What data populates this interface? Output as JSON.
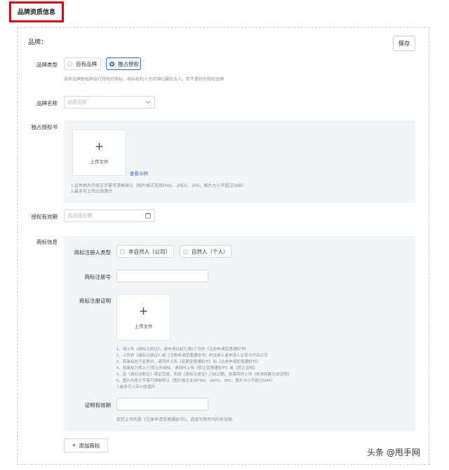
{
  "header": {
    "title": "品牌资质信息"
  },
  "brand_section": {
    "label": "品牌：",
    "save_label": "保存"
  },
  "brand_type": {
    "label": "品牌类型",
    "options": [
      "自有品牌",
      "独占授权"
    ],
    "selected": "独占授权",
    "hint": "自有品牌即品牌自行持有的商标。商标权利人为店铺归属的法人。若不是则为授权品牌"
  },
  "brand_name": {
    "label": "品牌名称",
    "placeholder": "品牌名称"
  },
  "license": {
    "label": "独占授权书",
    "upload_text": "上传文件",
    "example_link": "查看示例",
    "hints": [
      "1.证件图片内容文字需可清晰辨认（图片格式支持PNG、JPEG、JPG，图片大小不超过5MB）",
      "2.最多可上传20张图片"
    ]
  },
  "validity": {
    "label": "授权有效期",
    "placeholder": "请选择日期"
  },
  "trademark": {
    "label": "商标信息",
    "registrant_type_label": "商标注册人类型",
    "registrant_options": [
      "非自然人（公司）",
      "自然人（个人）"
    ],
    "reg_no_label": "商标注册号",
    "certificate_label": "商标注册证明",
    "upload_text": "上传文件",
    "hints": [
      "1、请上传《商标注册证》，或申请日起已满6个月的《注册申请受理通知书》",
      "2、上传的《商标注册证》或《注册申请受理通知书》的注册人或申请人必须为开店公司",
      "3、若商标处于变更中，请同时上传《变更受理通知书》和《注册申请受理通知书》",
      "4、若商标为转入/已转让的商标，请同时上传《转让受理通知书》或《转让证明》",
      "5、若《商标注册证》续证完成，而原《商标注册证》已经过期，则需同时上传《核准续展注册证明》",
      "6、图片内容文字需可清晰辨认（图片格式支持PNG、JEPG、JPG，图片大小不超过5MB）",
      "7.最多可上传20张图片"
    ],
    "cert_validity_label": "证明有效期",
    "cert_validity_hint": "若您上传的是《注册申请受理通知书》，请填写两年内的有效期"
  },
  "add_trademark": {
    "label": "添加商标"
  },
  "watermark": {
    "text": "头条 @甩手网"
  }
}
